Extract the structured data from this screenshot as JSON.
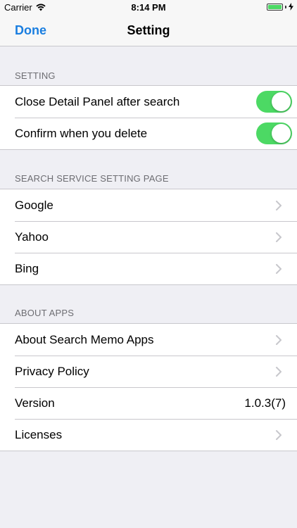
{
  "status_bar": {
    "carrier": "Carrier",
    "time": "8:14 PM",
    "icons": [
      "wifi-icon",
      "battery-icon",
      "charging-icon"
    ],
    "battery_color": "#4cd964"
  },
  "nav": {
    "done_label": "Done",
    "title": "Setting",
    "accent_color": "#1a7ee0"
  },
  "sections": {
    "setting": {
      "header": "SETTING",
      "items": [
        {
          "label": "Close Detail Panel after search",
          "toggle": true
        },
        {
          "label": "Confirm when you delete",
          "toggle": true
        }
      ]
    },
    "search_service": {
      "header": "SEARCH SERVICE SETTING PAGE",
      "items": [
        {
          "label": "Google"
        },
        {
          "label": "Yahoo"
        },
        {
          "label": "Bing"
        }
      ]
    },
    "about": {
      "header": "ABOUT APPS",
      "items": [
        {
          "label": "About Search Memo Apps"
        },
        {
          "label": "Privacy Policy"
        },
        {
          "label": "Version",
          "value": "1.0.3(7)"
        },
        {
          "label": "Licenses"
        }
      ]
    }
  },
  "toggle_on_color": "#4cd964"
}
